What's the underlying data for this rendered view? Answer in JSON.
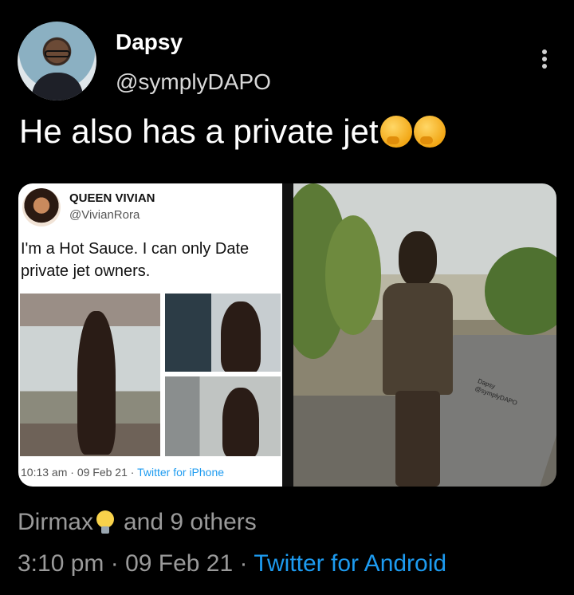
{
  "author": {
    "display_name": "Dapsy",
    "handle": "@symplyDAPO"
  },
  "tweet": {
    "text": "He also has a private jet",
    "emojis": [
      "thinking-face",
      "thinking-face"
    ]
  },
  "quoted_screenshot": {
    "name": "QUEEN VIVIAN",
    "handle": "@VivianRora",
    "text": "I'm a Hot Sauce. I can only Date private jet owners.",
    "time": "10:13 am",
    "sep1": " · ",
    "date": "09 Feb 21",
    "sep2": " · ",
    "source": "Twitter for iPhone"
  },
  "watermark": {
    "name": "Dapsy",
    "handle": "@symplyDAPO"
  },
  "likes": {
    "user": "Dirmax",
    "others": "and 9 others"
  },
  "footer": {
    "time": "3:10 pm",
    "sep1": " · ",
    "date": "09 Feb 21",
    "sep2": " · ",
    "source": "Twitter for Android"
  },
  "colors": {
    "background": "#000000",
    "link": "#1d9bf0",
    "secondary_text": "#9a9a9a"
  }
}
